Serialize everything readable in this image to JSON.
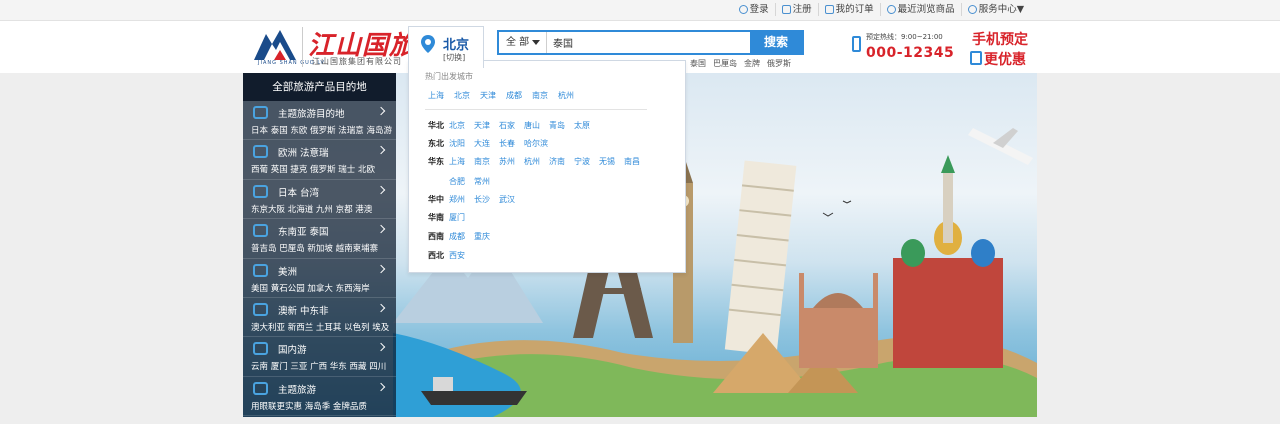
{
  "topbar": {
    "links": [
      {
        "label": "登录",
        "icon": "user-icon"
      },
      {
        "label": "注册",
        "icon": "edit-icon"
      },
      {
        "label": "我的订单",
        "icon": "order-icon"
      },
      {
        "label": "最近浏览商品",
        "icon": "clock-icon"
      },
      {
        "label": "服务中心▼",
        "icon": "headset-icon"
      }
    ]
  },
  "logo": {
    "mark_text": "江山国旅",
    "name": "江山国旅",
    "group": "江山国旅集团有限公司",
    "sub": "JIANG SHAN GUO LV"
  },
  "city": {
    "name": "北京",
    "switch_label": "[切换]"
  },
  "search": {
    "category": "全 部",
    "value": "泰国",
    "button": "搜索",
    "hot_words": [
      "泰国",
      "巴厘岛",
      "金牌",
      "俄罗斯"
    ]
  },
  "hotline": {
    "label": "预定热线：9:00~21:00",
    "number": "000-12345"
  },
  "mobile_promo": {
    "line1": "手机预定",
    "line2": "更优惠"
  },
  "menu": {
    "title": "全部旅游产品目的地",
    "items": [
      {
        "title": "主题旅游目的地",
        "sub": "日本 泰国 东欧 俄罗斯 法瑞意 海岛游",
        "icon": "sun-icon"
      },
      {
        "title": "欧洲 法意瑞",
        "sub": "西葡 英国 捷克 俄罗斯 瑞士 北欧",
        "icon": "camera-icon"
      },
      {
        "title": "日本 台湾",
        "sub": "东京大阪 北海道 九州 京都 港澳",
        "icon": "chef-icon"
      },
      {
        "title": "东南亚 泰国",
        "sub": "普吉岛 巴厘岛 新加坡 越南柬埔寨",
        "icon": "goggles-icon"
      },
      {
        "title": "美洲",
        "sub": "美国 黄石公园 加拿大 东西海岸",
        "icon": "robot-icon"
      },
      {
        "title": "澳新 中东非",
        "sub": "澳大利亚 新西兰 土耳其 以色列 埃及",
        "icon": "suitcase-icon"
      },
      {
        "title": "国内游",
        "sub": "云南 厦门 三亚 广西 华东 西藏 四川",
        "icon": "tent-icon"
      },
      {
        "title": "主题旅游",
        "sub": "用眼联更实惠 海岛季 金牌品质",
        "icon": "plane-icon"
      }
    ]
  },
  "dropdown": {
    "hot_title": "热门出发城市",
    "hot_cities": [
      "上海",
      "北京",
      "天津",
      "成都",
      "南京",
      "杭州"
    ],
    "regions": [
      {
        "name": "华北",
        "cities": [
          "北京",
          "天津",
          "石家",
          "唐山",
          "青岛",
          "太原"
        ]
      },
      {
        "name": "东北",
        "cities": [
          "沈阳",
          "大连",
          "长春",
          "哈尔滨"
        ]
      },
      {
        "name": "华东",
        "cities": [
          "上海",
          "南京",
          "苏州",
          "杭州",
          "济南",
          "宁波",
          "无锡",
          "南昌",
          "合肥",
          "常州"
        ]
      },
      {
        "name": "华中",
        "cities": [
          "郑州",
          "长沙",
          "武汉"
        ]
      },
      {
        "name": "华南",
        "cities": [
          "厦门"
        ]
      },
      {
        "name": "西南",
        "cities": [
          "成都",
          "重庆"
        ]
      },
      {
        "name": "西北",
        "cities": [
          "西安"
        ]
      }
    ]
  },
  "colors": {
    "accent": "#2f8ad8",
    "brand_red": "#d8232a",
    "menu_bg": "#0c1a2c"
  }
}
